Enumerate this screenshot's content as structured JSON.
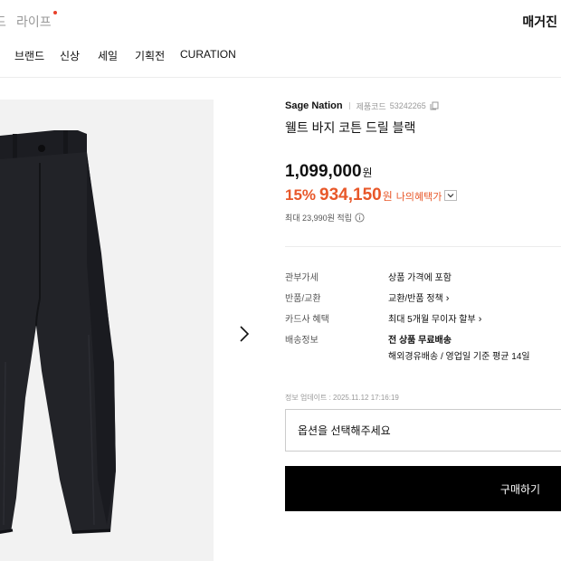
{
  "header": {
    "tab_cut": "드",
    "tab_life": "라이프",
    "magazine": "매거진"
  },
  "nav": {
    "items": [
      "브랜드",
      "신상",
      "세일",
      "기획전",
      "CURATION"
    ]
  },
  "product": {
    "brand": "Sage Nation",
    "code_label": "제품코드",
    "code": "53242265",
    "name": "웰트 바지 코튼 드릴 블랙",
    "original_price": "1,099,000",
    "currency": "원",
    "discount": "15%",
    "sale_price": "934,150",
    "benefit_label": "나의혜택가",
    "points_text": "최대 23,990원 적립"
  },
  "specs": [
    {
      "label": "관부가세",
      "value": "상품 가격에 포함"
    },
    {
      "label": "반품/교환",
      "value": "교환/반품 정책"
    },
    {
      "label": "카드사 혜택",
      "value": "최대 5개월 무이자 할부"
    },
    {
      "label": "배송정보",
      "value": "전 상품 무료배송",
      "value2": "해외경유배송 / 영업일 기준 평균 14일"
    }
  ],
  "updated": "정보 업데이트 : 2025.11.12 17:16:19",
  "option_placeholder": "옵션을 선택해주세요",
  "buy_label": "구매하기",
  "colors": {
    "accent": "#e8582a",
    "dot": "#e8402a",
    "button": "#000000"
  }
}
